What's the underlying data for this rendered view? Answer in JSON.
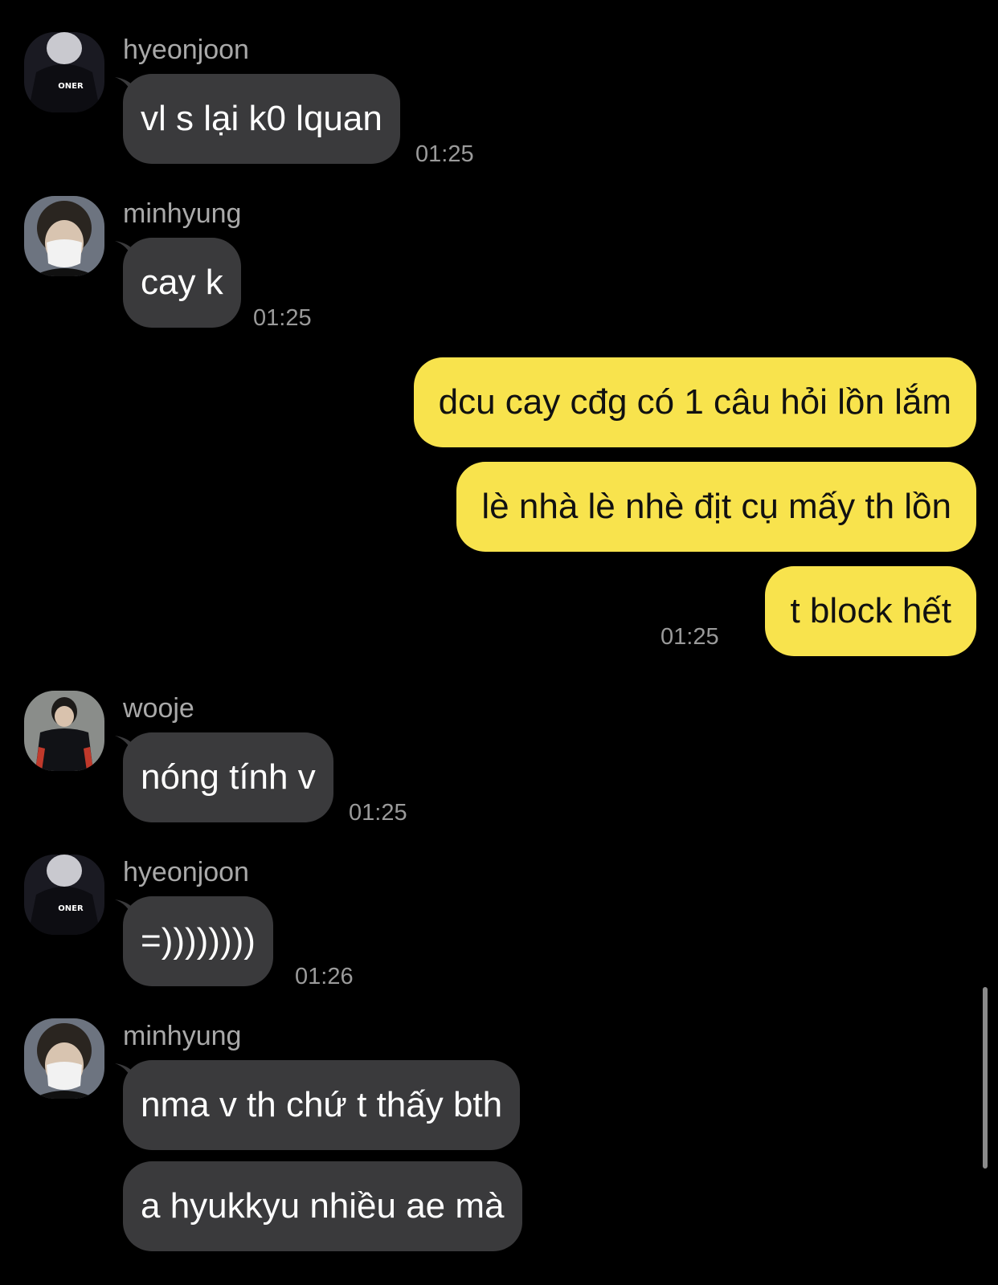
{
  "colors": {
    "background": "#000000",
    "incoming_bubble": "#3a3a3c",
    "outgoing_bubble": "#f8e34d",
    "sender_name": "#a9a9a9",
    "timestamp": "#9a9a9a"
  },
  "messages": [
    {
      "sender": "hyeonjoon",
      "avatar": "hyeonjoon-avatar",
      "text": "vl s lại k0 lquan",
      "time": "01:25"
    },
    {
      "sender": "minhyung",
      "avatar": "minhyung-avatar",
      "text": "cay k",
      "time": "01:25"
    },
    {
      "from_me": true,
      "texts": [
        "dcu cay cđg có 1 câu hỏi lồn lắm",
        "lè nhà lè nhè địt cụ mấy th lồn",
        "t block hết"
      ],
      "time": "01:25"
    },
    {
      "sender": "wooje",
      "avatar": "wooje-avatar",
      "text": "nóng tính v",
      "time": "01:25"
    },
    {
      "sender": "hyeonjoon",
      "avatar": "hyeonjoon-avatar",
      "text": "=))))))))",
      "time": "01:26"
    },
    {
      "sender": "minhyung",
      "avatar": "minhyung-avatar",
      "texts": [
        "nma v th chứ t thấy bth",
        "a hyukkyu nhiều ae mà"
      ]
    }
  ]
}
